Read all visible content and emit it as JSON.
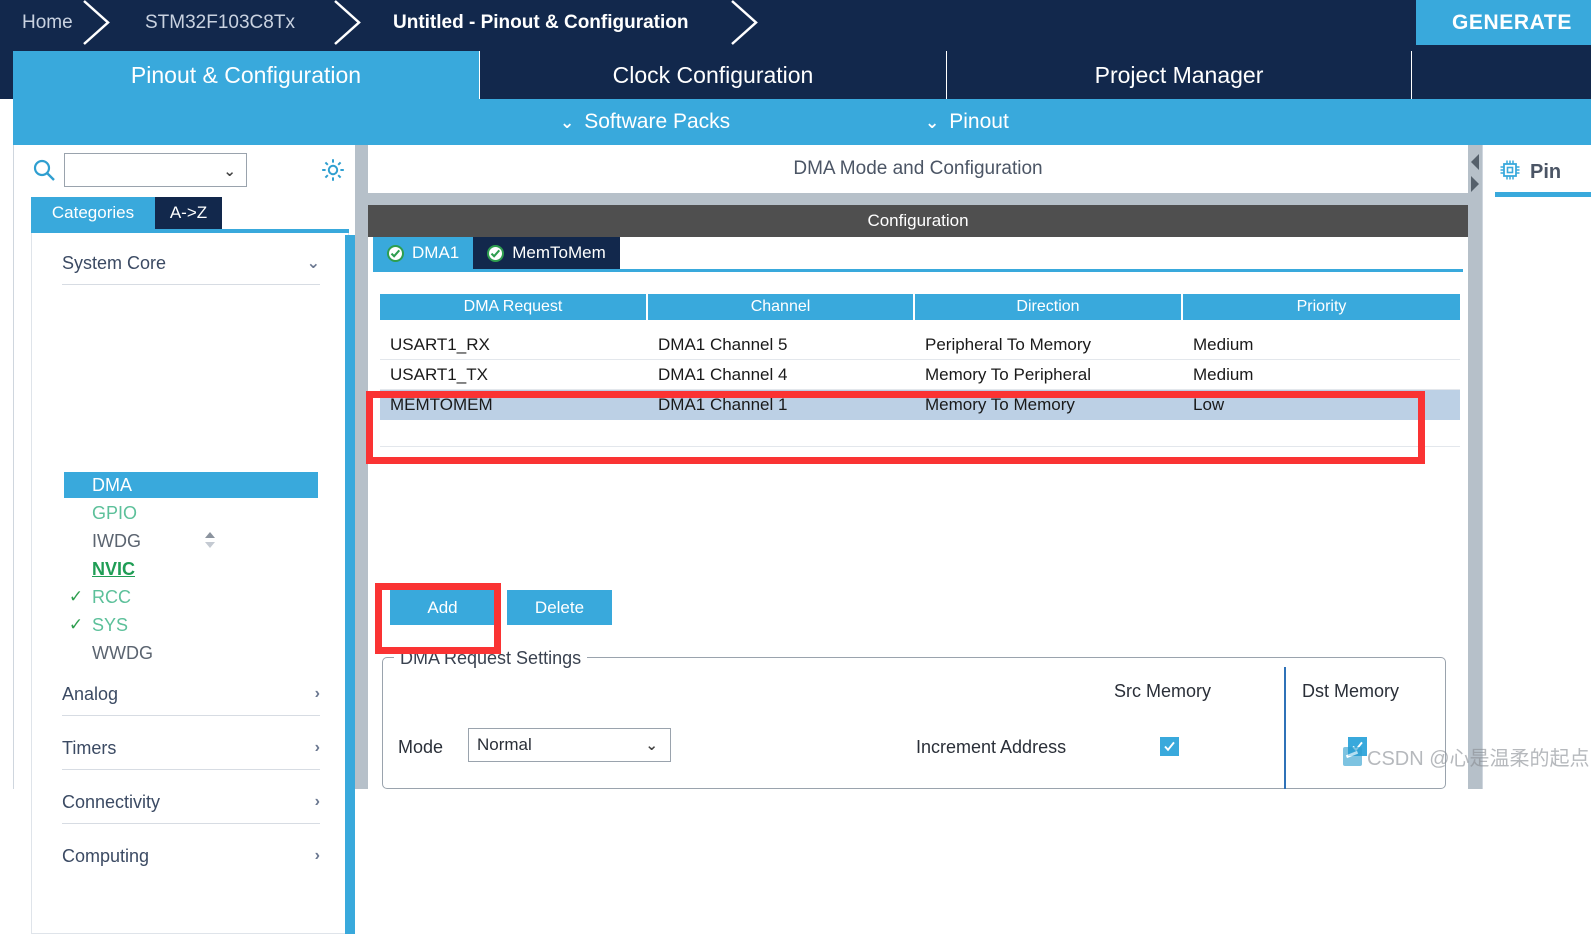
{
  "breadcrumb": {
    "items": [
      {
        "label": "Home",
        "current": false
      },
      {
        "label": "STM32F103C8Tx",
        "current": false
      },
      {
        "label": "Untitled - Pinout & Configuration",
        "current": true
      }
    ]
  },
  "generate_button": {
    "label": "GENERATE"
  },
  "main_tabs": [
    {
      "label": "Pinout & Configuration",
      "active": true
    },
    {
      "label": "Clock Configuration",
      "active": false
    },
    {
      "label": "Project Manager",
      "active": false
    },
    {
      "label": "",
      "active": false
    }
  ],
  "sub_tabs": [
    {
      "label": "Software Packs",
      "caret": "chevron-down-icon"
    },
    {
      "label": "Pinout",
      "caret": "chevron-down-icon"
    }
  ],
  "sidebar": {
    "search": {
      "value": "",
      "placeholder": "",
      "icon": "search-icon"
    },
    "gear_icon": "gear-icon",
    "category_tabs": [
      {
        "label": "Categories",
        "selected": true
      },
      {
        "label": "A->Z",
        "selected": false
      }
    ],
    "groups": [
      {
        "label": "System Core",
        "expanded": true
      },
      {
        "label": "Analog",
        "expanded": false
      },
      {
        "label": "Timers",
        "expanded": false
      },
      {
        "label": "Connectivity",
        "expanded": false
      },
      {
        "label": "Computing",
        "expanded": false
      }
    ],
    "peripherals": [
      {
        "label": "DMA",
        "selected": true,
        "checked": false,
        "style": "selected"
      },
      {
        "label": "GPIO",
        "selected": false,
        "checked": false,
        "style": "green"
      },
      {
        "label": "IWDG",
        "selected": false,
        "checked": false,
        "style": "gray"
      },
      {
        "label": "NVIC",
        "selected": false,
        "checked": false,
        "style": "nvic"
      },
      {
        "label": "RCC",
        "selected": false,
        "checked": true,
        "style": "green"
      },
      {
        "label": "SYS",
        "selected": false,
        "checked": true,
        "style": "green"
      },
      {
        "label": "WWDG",
        "selected": false,
        "checked": false,
        "style": "gray"
      }
    ]
  },
  "main": {
    "mode_header": "DMA Mode and Configuration",
    "configuration_bar": "Configuration",
    "inner_tabs": [
      {
        "label": "DMA1",
        "active": true,
        "badge": "check-circle-icon"
      },
      {
        "label": "MemToMem",
        "active": false,
        "badge": "check-circle-icon"
      }
    ],
    "table": {
      "columns": [
        "DMA Request",
        "Channel",
        "Direction",
        "Priority"
      ],
      "rows": [
        {
          "request": "USART1_RX",
          "channel": "DMA1 Channel 5",
          "direction": "Peripheral To Memory",
          "priority": "Medium",
          "selected": false
        },
        {
          "request": "USART1_TX",
          "channel": "DMA1 Channel 4",
          "direction": "Memory To Peripheral",
          "priority": "Medium",
          "selected": false
        },
        {
          "request": "MEMTOMEM",
          "channel": "DMA1 Channel 1",
          "direction": "Memory To Memory",
          "priority": "Low",
          "selected": true
        }
      ]
    },
    "buttons": {
      "add": "Add",
      "delete": "Delete"
    },
    "settings": {
      "legend": "DMA Request Settings",
      "src_memory": "Src Memory",
      "dst_memory": "Dst Memory",
      "mode_label": "Mode",
      "mode_value": "Normal",
      "increment_label": "Increment Address",
      "src_increment_checked": true,
      "dst_increment_checked": true
    }
  },
  "pin_panel": {
    "title": "Pin",
    "icon": "chip-icon"
  },
  "watermark": {
    "text": "CSDN @心是温柔的起点"
  },
  "colors": {
    "navy": "#12284c",
    "accent_blue": "#39a9dc",
    "selection_blue": "#bcd0e5",
    "annotation_red": "#fa3333",
    "check_green": "#2e9e4f",
    "splitter_gray": "#b6c0c9",
    "config_bar_gray": "#4f4f4f"
  }
}
